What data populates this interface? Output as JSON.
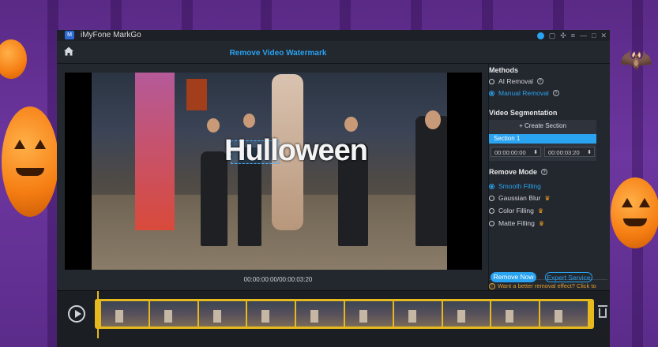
{
  "app": {
    "name": "iMyFone MarkGo",
    "page_title": "Remove Video Watermark"
  },
  "watermark_text": "Hulloween",
  "player": {
    "timecode": "00:00:00:00/00:00:03:20"
  },
  "methods": {
    "heading": "Methods",
    "options": [
      {
        "label": "AI Removal",
        "selected": false
      },
      {
        "label": "Manual Removal",
        "selected": true
      }
    ]
  },
  "segmentation": {
    "heading": "Video Segmentation",
    "create_label": "+ Create Section",
    "section_label": "Section 1",
    "start": "00:00:00:00",
    "end": "00:00:03:20"
  },
  "remove_mode": {
    "heading": "Remove Mode",
    "options": [
      {
        "label": "Smooth Filling",
        "selected": true
      },
      {
        "label": "Gaussian Blur",
        "selected": false
      },
      {
        "label": "Color Filling",
        "selected": false
      },
      {
        "label": "Matte Filling",
        "selected": false
      }
    ]
  },
  "tip": "Want a better removal effect? Click to view the ultimate tutorial>",
  "buttons": {
    "remove_now": "Remove Now",
    "expert_service": "Expert Service"
  },
  "colors": {
    "accent": "#2aa3f0",
    "timeline_track": "#e6b91e",
    "warning": "#e1a030"
  }
}
